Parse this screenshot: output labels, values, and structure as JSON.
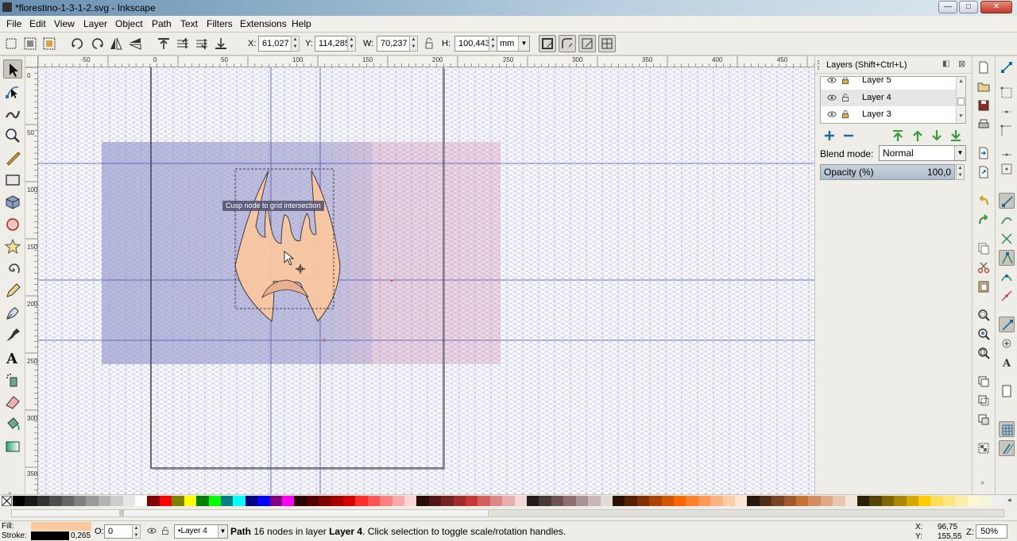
{
  "window": {
    "title": "*florestino-1-3-1-2.svg - Inkscape",
    "buttons": {
      "minimize": "—",
      "maximize": "□",
      "close": "✕"
    }
  },
  "menubar": [
    "File",
    "Edit",
    "View",
    "Layer",
    "Object",
    "Path",
    "Text",
    "Filters",
    "Extensions",
    "Help"
  ],
  "tool_controls": {
    "x_label": "X:",
    "x_value": "61,027",
    "y_label": "Y:",
    "y_value": "114,285",
    "w_label": "W:",
    "w_value": "70,237",
    "h_label": "H:",
    "h_value": "100,443",
    "unit": "mm",
    "icons": [
      "select-all-icon",
      "select-all-layers-icon",
      "deselect-icon",
      "rotate-ccw-icon",
      "rotate-cw-icon",
      "flip-horizontal-icon",
      "flip-vertical-icon",
      "raise-to-top-icon",
      "raise-icon",
      "lower-icon",
      "lower-to-bottom-icon",
      "lock-ratio-icon",
      "scale-stroke-icon",
      "scale-corners-icon",
      "transform-gradient-icon",
      "transform-pattern-icon"
    ]
  },
  "ruler": {
    "horizontal_labels": [
      "-50",
      "0",
      "50",
      "100",
      "150",
      "200",
      "250",
      "300",
      "350",
      "400",
      "450"
    ],
    "vertical_labels": [
      "0",
      "50",
      "100",
      "150",
      "200",
      "250",
      "300",
      "350"
    ]
  },
  "canvas": {
    "snap_tooltip": "Cusp node to grid intersection",
    "page_color": "#ffffff",
    "grid_color": "#7b7fc0",
    "shape_fill": "#fcc8a0"
  },
  "layers_panel": {
    "title": "Layers (Shift+Ctrl+L)",
    "layers": [
      {
        "name": "Layer 5",
        "selected": false
      },
      {
        "name": "Layer 4",
        "selected": true
      },
      {
        "name": "Layer 3",
        "selected": false
      }
    ],
    "blend_label": "Blend mode:",
    "blend_value": "Normal",
    "opacity_label": "Opacity (%)",
    "opacity_value": "100,0"
  },
  "palette": {
    "colors": [
      "#000000",
      "#1a1a1a",
      "#333333",
      "#4d4d4d",
      "#666666",
      "#808080",
      "#999999",
      "#b3b3b3",
      "#cccccc",
      "#e6e6e6",
      "#ffffff",
      "#800000",
      "#ff0000",
      "#808000",
      "#ffff00",
      "#008000",
      "#00ff00",
      "#008080",
      "#00ffff",
      "#000080",
      "#0000ff",
      "#800080",
      "#ff00ff",
      "#2b0000",
      "#550000",
      "#800000",
      "#aa0000",
      "#d40000",
      "#ff2a2a",
      "#ff5555",
      "#ff8080",
      "#ffaaaa",
      "#ffd5d5",
      "#280b0b",
      "#501616",
      "#782121",
      "#a02c2c",
      "#c83737",
      "#d35f5f",
      "#de8787",
      "#e9afaf",
      "#f4d7d7",
      "#241c1c",
      "#483737",
      "#6c5353",
      "#916f6f",
      "#ac9393",
      "#c8b7b7",
      "#e3dbdb",
      "#2b1100",
      "#552200",
      "#803300",
      "#aa4400",
      "#d45500",
      "#ff6600",
      "#ff7f2a",
      "#ff9955",
      "#ffb380",
      "#ffccaa",
      "#ffe6d5",
      "#28170b",
      "#502d16",
      "#784421",
      "#a05a2c",
      "#c87137",
      "#d38d5f",
      "#deaa87",
      "#e9c6af",
      "#f4e3d7",
      "#2b2200",
      "#554400",
      "#806600",
      "#aa8800",
      "#d4aa00",
      "#ffcc00",
      "#ffdd55",
      "#ffe680",
      "#ffeeaa",
      "#fff6d5",
      "#f5f5dc",
      "#eeeeee"
    ]
  },
  "statusbar": {
    "fill_label": "Fill:",
    "stroke_label": "Stroke:",
    "stroke_width": "0,265",
    "o_label": "O:",
    "o_value": "0",
    "layer_value": "•Layer 4",
    "message_bold": "Path",
    "message_rest": " 16 nodes in layer ",
    "message_layer": "Layer 4",
    "message_end": ". Click selection to toggle scale/rotation handles.",
    "x_label": "X:",
    "x_value": "96,75",
    "y_label": "Y:",
    "y_value": "155,55",
    "z_label": "Z:",
    "zoom_value": "50%"
  }
}
